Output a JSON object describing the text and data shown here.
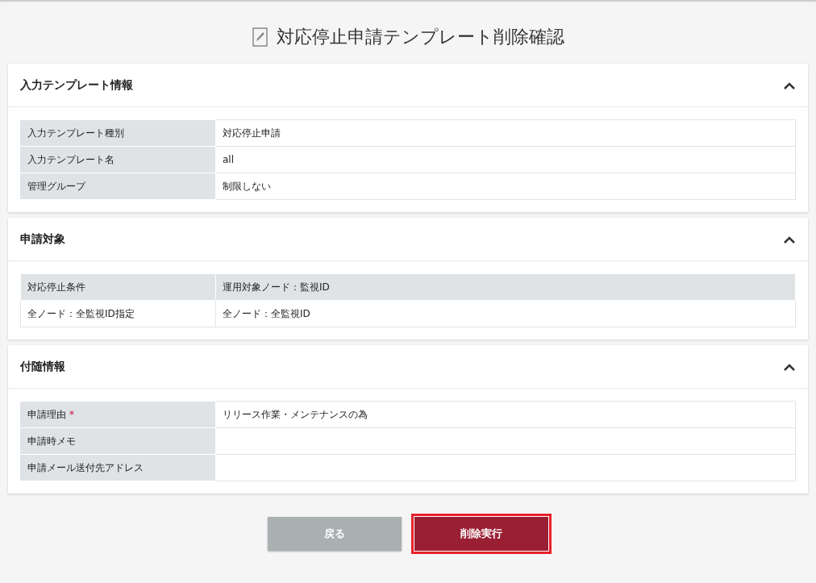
{
  "page_title": "対応停止申請テンプレート削除確認",
  "sections": [
    {
      "title": "入力テンプレート情報",
      "expanded": true,
      "kind": "kv",
      "rows": [
        {
          "label": "入力テンプレート種別",
          "value": "対応停止申請"
        },
        {
          "label": "入力テンプレート名",
          "value": "all"
        },
        {
          "label": "管理グループ",
          "value": "制限しない"
        }
      ]
    },
    {
      "title": "申請対象",
      "expanded": true,
      "kind": "grid",
      "columns": [
        "対応停止条件",
        "運用対象ノード：監視ID"
      ],
      "rows": [
        [
          "全ノード：全監視ID指定",
          "全ノード：全監視ID"
        ]
      ]
    },
    {
      "title": "付随情報",
      "expanded": true,
      "kind": "kv",
      "rows": [
        {
          "label": "申請理由",
          "required_mark": "*",
          "value": "リリース作業・メンテナンスの為"
        },
        {
          "label": "申請時メモ",
          "value": ""
        },
        {
          "label": "申請メール送付先アドレス",
          "value": ""
        }
      ]
    }
  ],
  "buttons": [
    {
      "label": "戻る",
      "kind": "secondary",
      "focused": false
    },
    {
      "label": "削除実行",
      "kind": "danger",
      "focused": true
    }
  ]
}
